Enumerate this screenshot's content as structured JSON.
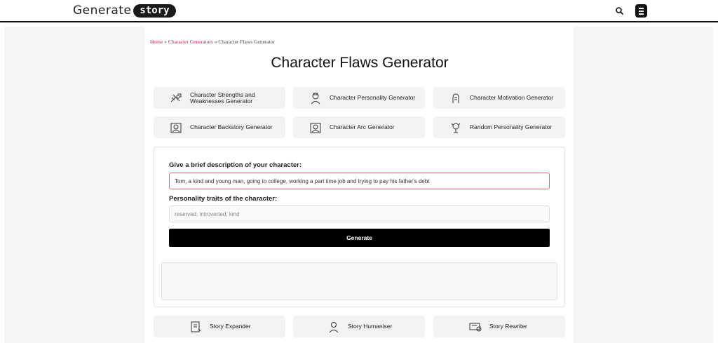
{
  "header": {
    "logo_word": "Generate",
    "logo_pill": "story",
    "search_icon": "search-icon",
    "menu_icon": "menu-icon"
  },
  "breadcrumb": {
    "home": "Home",
    "sep1": " » ",
    "category": "Character Generators",
    "sep2": " » ",
    "current": "Character Flaws Generator"
  },
  "page_title": "Character Flaws Generator",
  "generator_links": [
    {
      "label": "Character Strengths and Weaknesses Generator",
      "icon": "strengths-icon"
    },
    {
      "label": "Character Personality Generator",
      "icon": "personality-icon"
    },
    {
      "label": "Character Motivation Generator",
      "icon": "motivation-icon"
    },
    {
      "label": "Character Backstory Generator",
      "icon": "backstory-icon"
    },
    {
      "label": "Character Arc Generator",
      "icon": "arc-icon"
    },
    {
      "label": "Random Personality Generator",
      "icon": "random-personality-icon"
    }
  ],
  "form": {
    "description_label": "Give a brief description of your character:",
    "description_value": "Tom, a kind and young man, going to college, working a part time job and trying to pay his father's debt",
    "traits_label": "Personality traits of the character:",
    "traits_value": "",
    "traits_placeholder": "reserved, introverted, kind",
    "generate_label": "Generate"
  },
  "tool_links": [
    {
      "label": "Story Expander",
      "icon": "expander-icon"
    },
    {
      "label": "Story Humaniser",
      "icon": "humaniser-icon"
    },
    {
      "label": "Story Rewriter",
      "icon": "rewriter-icon"
    }
  ],
  "colors": {
    "accent_link": "#c2185b",
    "button_bg": "#000000",
    "input_error_border": "#d46a6a"
  }
}
